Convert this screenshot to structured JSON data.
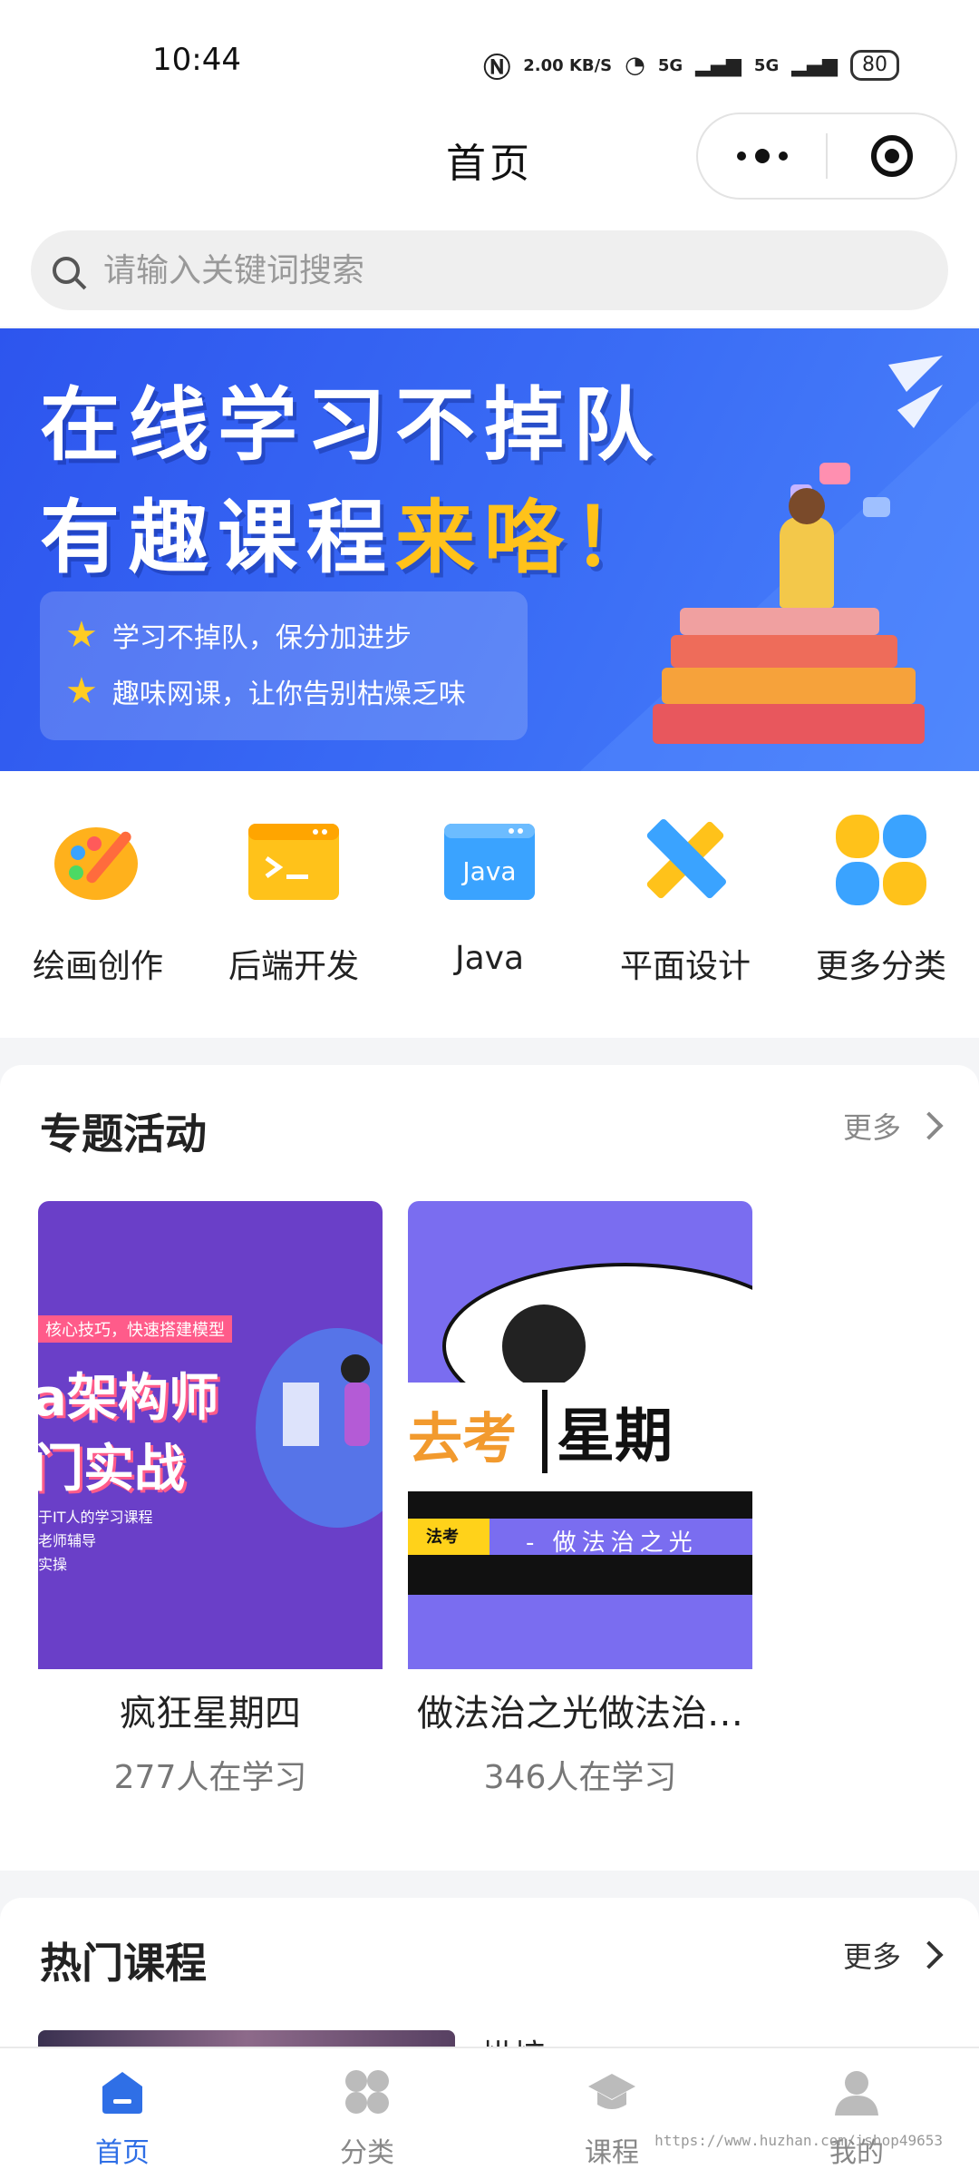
{
  "status_bar": {
    "time": "10:44",
    "net_speed": "2.00 KB/S",
    "signal_1": "5G",
    "signal_2": "5G",
    "battery": "80"
  },
  "navbar": {
    "title": "首页"
  },
  "search": {
    "placeholder": "请输入关键词搜索"
  },
  "banner": {
    "line1": "在线学习不掉队",
    "line2_white": "有趣课程",
    "line2_highlight": "来咯！",
    "points": [
      "学习不掉队，保分加进步",
      "趣味网课，让你告别枯燥乏味"
    ],
    "accent_color": "#ffc21a",
    "bg_color": "#3a6cf5"
  },
  "categories": [
    {
      "label": "绘画创作",
      "icon": "palette-icon"
    },
    {
      "label": "后端开发",
      "icon": "terminal-icon"
    },
    {
      "label": "Java",
      "icon": "java-icon",
      "icon_text": "Java"
    },
    {
      "label": "平面设计",
      "icon": "ruler-pencil-icon"
    },
    {
      "label": "更多分类",
      "icon": "grid-icon"
    }
  ],
  "special": {
    "title": "专题活动",
    "more_label": "更多",
    "items": [
      {
        "name": "疯狂星期四",
        "count": "277人在学习",
        "poster": {
          "tag": "核心技巧，快速搭建模型",
          "title1": "a架构师",
          "title2": "门实战",
          "lines": [
            "于IT人的学习课程",
            "老师辅导",
            "实操"
          ]
        }
      },
      {
        "name": "做法治之光做法治…",
        "count": "346人在学习",
        "poster": {
          "left": "去考",
          "right": "星期",
          "logo": "法考",
          "sub": "- 做法治之光"
        }
      }
    ]
  },
  "hot": {
    "title": "热门课程",
    "more_label": "更多",
    "first_item_partial": "烘焙"
  },
  "tabbar": [
    {
      "label": "首页",
      "icon": "home-icon",
      "active": true
    },
    {
      "label": "分类",
      "icon": "category-icon",
      "active": false
    },
    {
      "label": "课程",
      "icon": "graduation-cap-icon",
      "active": false
    },
    {
      "label": "我的",
      "icon": "user-icon",
      "active": false
    }
  ],
  "watermark": "https://www.huzhan.com/ishop49653",
  "colors": {
    "primary": "#2f6fe6",
    "tab_inactive": "#b8b8b8"
  }
}
